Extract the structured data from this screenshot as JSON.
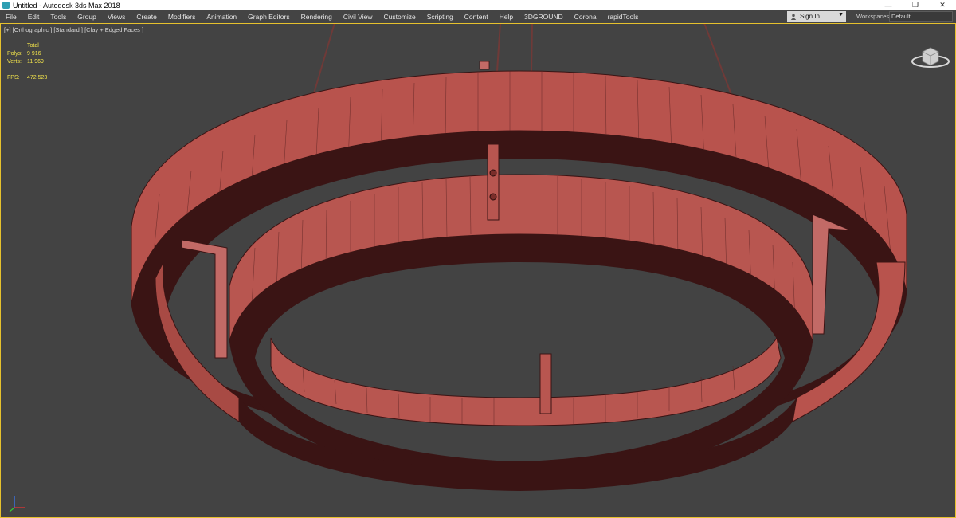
{
  "window": {
    "title": "Untitled - Autodesk 3ds Max 2018",
    "controls": {
      "minimize": "—",
      "restore": "❐",
      "close": "✕"
    }
  },
  "menubar": {
    "items": [
      {
        "label": "File"
      },
      {
        "label": "Edit"
      },
      {
        "label": "Tools"
      },
      {
        "label": "Group"
      },
      {
        "label": "Views"
      },
      {
        "label": "Create"
      },
      {
        "label": "Modifiers"
      },
      {
        "label": "Animation"
      },
      {
        "label": "Graph Editors"
      },
      {
        "label": "Rendering"
      },
      {
        "label": "Civil View"
      },
      {
        "label": "Customize"
      },
      {
        "label": "Scripting"
      },
      {
        "label": "Content"
      },
      {
        "label": "Help"
      },
      {
        "label": "3DGROUND"
      },
      {
        "label": "Corona"
      },
      {
        "label": "rapidTools"
      }
    ],
    "sign_in": "Sign In",
    "workspaces_label": "Workspaces:",
    "workspace_value": "Default"
  },
  "viewport": {
    "label": "[+] [Orthographic ] [Standard ] [Clay + Edged Faces ]",
    "stats": {
      "header": "Total",
      "polys_label": "Polys:",
      "polys_value": "9 916",
      "verts_label": "Verts:",
      "verts_value": "11 969",
      "fps_label": "FPS:",
      "fps_value": "472,523"
    }
  },
  "colors": {
    "frame_active": "#e6c12d",
    "viewport_bg": "#434343",
    "model_face": "#b85650",
    "model_dark": "#3a1414",
    "stats_text": "#f2e34b"
  }
}
